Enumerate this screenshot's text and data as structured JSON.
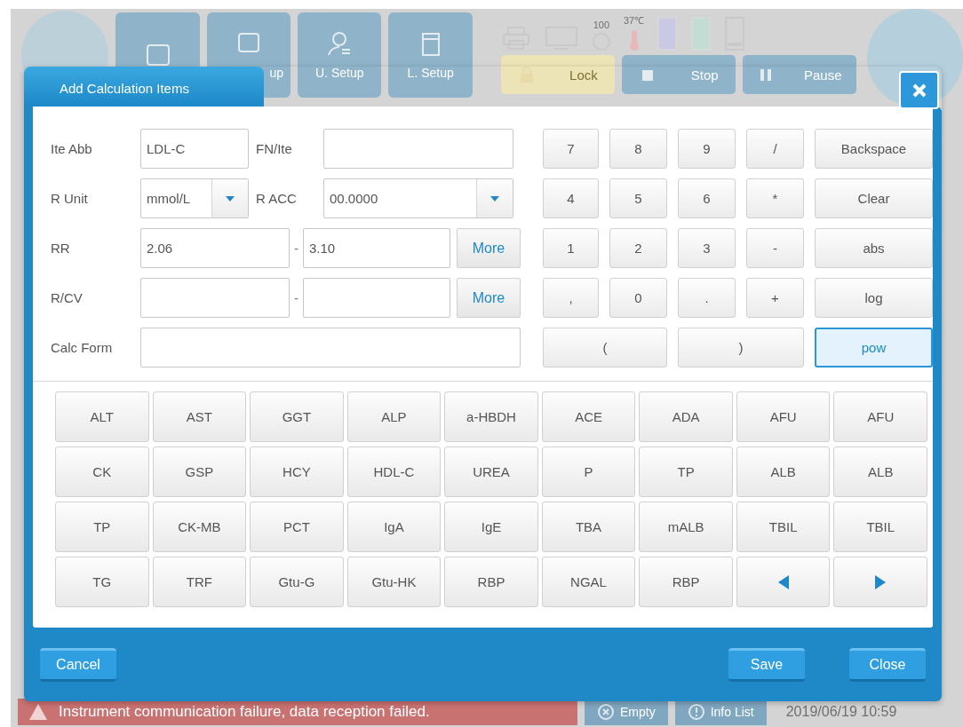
{
  "background": {
    "tiles": [
      {
        "label": "up"
      },
      {
        "label": "U. Setup"
      },
      {
        "label": "L. Setup"
      }
    ],
    "indicators": [
      {
        "label": "100"
      },
      {
        "label": "37℃"
      }
    ],
    "controls": [
      {
        "kind": "lock",
        "label": "Lock"
      },
      {
        "kind": "stop",
        "label": "Stop"
      },
      {
        "kind": "pause",
        "label": "Pause"
      }
    ],
    "status_bar": {
      "message": "Instrument communication failure, data reception failed.",
      "buttons": [
        {
          "kind": "empty",
          "label": "Empty"
        },
        {
          "kind": "info",
          "label": "Info List"
        }
      ],
      "datetime": "2019/06/19 10:59"
    }
  },
  "dialog": {
    "title": "Add Calculation Items",
    "form": {
      "rows": [
        {
          "kind": "pair",
          "fields": [
            {
              "label": "Ite Abb",
              "kind": "text",
              "value": "LDL-C"
            },
            {
              "label": "FN/Ite",
              "kind": "text"
            }
          ]
        },
        {
          "kind": "pair",
          "fields": [
            {
              "label": "R Unit",
              "kind": "select",
              "value": "mmol/L"
            },
            {
              "label": "R ACC",
              "kind": "select",
              "value": "00.0000"
            }
          ]
        },
        {
          "kind": "range",
          "label": "RR",
          "low": "2.06",
          "separator": "-",
          "high": "3.10",
          "button": "More"
        },
        {
          "kind": "range",
          "label": "R/CV",
          "separator": "-",
          "button": "More"
        },
        {
          "kind": "single",
          "label": "Calc Form"
        }
      ]
    },
    "keypad": [
      {
        "label": "7",
        "selected": false
      },
      {
        "label": "8",
        "selected": false
      },
      {
        "label": "9",
        "selected": false
      },
      {
        "label": "/",
        "selected": false
      },
      {
        "label": "Backspace",
        "selected": false
      },
      {
        "label": "4",
        "selected": false
      },
      {
        "label": "5",
        "selected": false
      },
      {
        "label": "6",
        "selected": false
      },
      {
        "label": "*",
        "selected": false
      },
      {
        "label": "Clear",
        "selected": false
      },
      {
        "label": "1",
        "selected": false
      },
      {
        "label": "2",
        "selected": false
      },
      {
        "label": "3",
        "selected": false
      },
      {
        "label": "-",
        "selected": false
      },
      {
        "label": "abs",
        "selected": false
      },
      {
        "label": ",",
        "selected": false
      },
      {
        "label": "0",
        "selected": false
      },
      {
        "label": ".",
        "selected": false
      },
      {
        "label": "+",
        "selected": false
      },
      {
        "label": "log",
        "selected": false
      },
      {
        "label": "(",
        "selected": false
      },
      {
        "label": ")",
        "selected": false
      },
      {
        "label": "pow",
        "selected": true
      }
    ],
    "items": [
      {
        "kind": "item",
        "label": "ALT"
      },
      {
        "kind": "item",
        "label": "AST"
      },
      {
        "kind": "item",
        "label": "GGT"
      },
      {
        "kind": "item",
        "label": "ALP"
      },
      {
        "kind": "item",
        "label": "a-HBDH"
      },
      {
        "kind": "item",
        "label": "ACE"
      },
      {
        "kind": "item",
        "label": "ADA"
      },
      {
        "kind": "item",
        "label": "AFU"
      },
      {
        "kind": "item",
        "label": "AFU"
      },
      {
        "kind": "item",
        "label": "CK"
      },
      {
        "kind": "item",
        "label": "GSP"
      },
      {
        "kind": "item",
        "label": "HCY"
      },
      {
        "kind": "item",
        "label": "HDL-C"
      },
      {
        "kind": "item",
        "label": "UREA"
      },
      {
        "kind": "item",
        "label": "P"
      },
      {
        "kind": "item",
        "label": "TP"
      },
      {
        "kind": "item",
        "label": "ALB"
      },
      {
        "kind": "item",
        "label": "ALB"
      },
      {
        "kind": "item",
        "label": "TP"
      },
      {
        "kind": "item",
        "label": "CK-MB"
      },
      {
        "kind": "item",
        "label": "PCT"
      },
      {
        "kind": "item",
        "label": "IgA"
      },
      {
        "kind": "item",
        "label": "IgE"
      },
      {
        "kind": "item",
        "label": "TBA"
      },
      {
        "kind": "item",
        "label": "mALB"
      },
      {
        "kind": "item",
        "label": "TBIL"
      },
      {
        "kind": "item",
        "label": "TBIL"
      },
      {
        "kind": "item",
        "label": "TG"
      },
      {
        "kind": "item",
        "label": "TRF"
      },
      {
        "kind": "item",
        "label": "Gtu-G"
      },
      {
        "kind": "item",
        "label": "Gtu-HK"
      },
      {
        "kind": "item",
        "label": "RBP"
      },
      {
        "kind": "item",
        "label": "NGAL"
      },
      {
        "kind": "item",
        "label": "RBP"
      },
      {
        "kind": "prev"
      },
      {
        "kind": "next"
      }
    ],
    "footer": {
      "left": [
        {
          "label": "Cancel"
        }
      ],
      "right": [
        {
          "label": "Save"
        },
        {
          "label": "Close"
        }
      ]
    }
  }
}
